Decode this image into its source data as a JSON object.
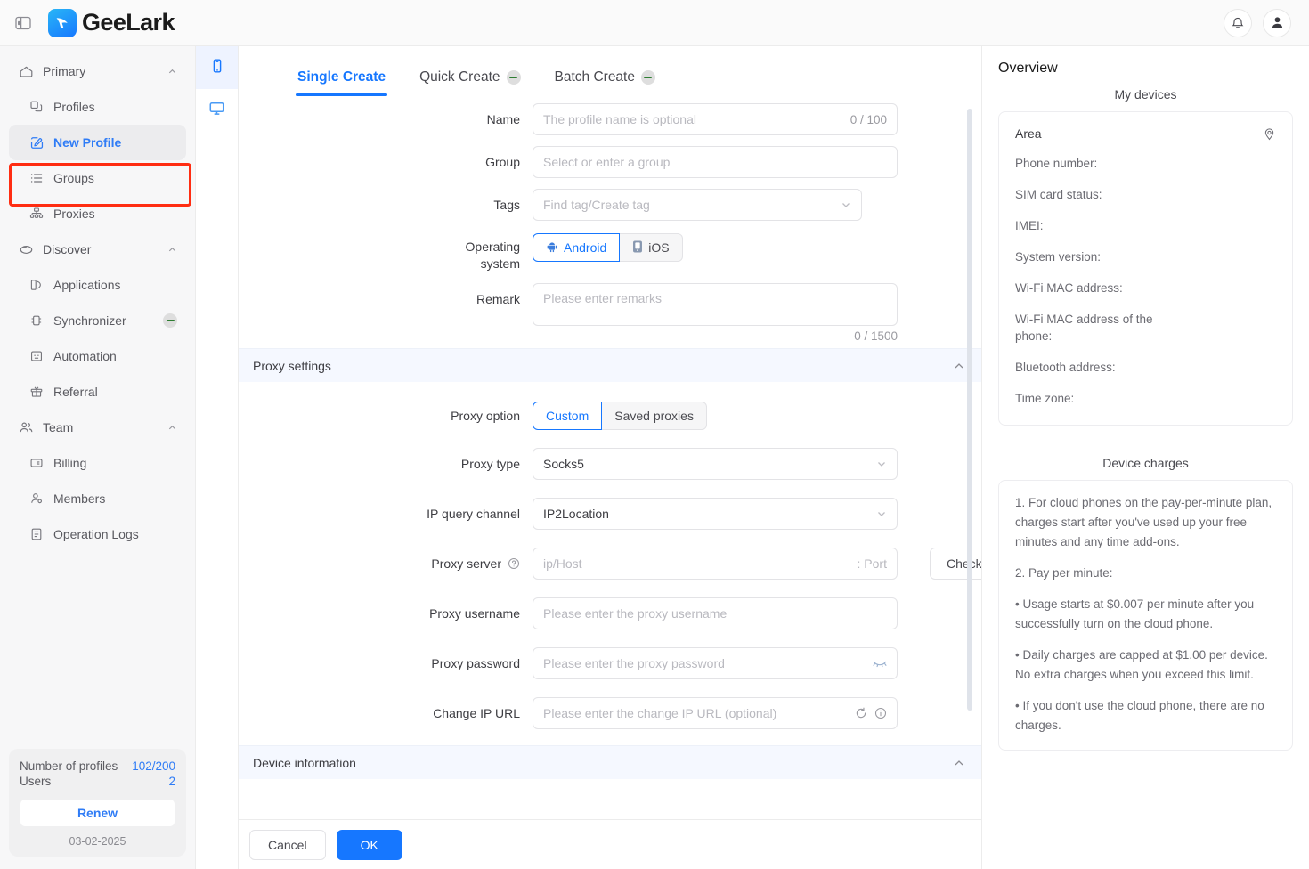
{
  "header": {
    "brand": "GeeLark",
    "panel_toggle_icon": "sidebar-toggle-icon",
    "notification_icon": "bell-icon",
    "account_icon": "user-avatar-icon"
  },
  "sidebar": {
    "groups": [
      {
        "label": "Primary",
        "icon": "home-icon",
        "expanded": true,
        "items": [
          {
            "label": "Profiles",
            "icon": "profiles-icon",
            "active": false
          },
          {
            "label": "New Profile",
            "icon": "edit-square-icon",
            "active": true
          },
          {
            "label": "Groups",
            "icon": "list-icon",
            "active": false
          },
          {
            "label": "Proxies",
            "icon": "network-icon",
            "active": false
          }
        ]
      },
      {
        "label": "Discover",
        "icon": "compass-icon",
        "expanded": true,
        "items": [
          {
            "label": "Applications",
            "icon": "apps-icon",
            "active": false
          },
          {
            "label": "Synchronizer",
            "icon": "sync-icon",
            "active": false,
            "badge": "broken-image-icon"
          },
          {
            "label": "Automation",
            "icon": "automation-icon",
            "active": false
          },
          {
            "label": "Referral",
            "icon": "gift-icon",
            "active": false
          }
        ]
      },
      {
        "label": "Team",
        "icon": "team-icon",
        "expanded": true,
        "items": [
          {
            "label": "Billing",
            "icon": "card-icon",
            "active": false
          },
          {
            "label": "Members",
            "icon": "member-icon",
            "active": false
          },
          {
            "label": "Operation Logs",
            "icon": "log-icon",
            "active": false
          }
        ]
      }
    ],
    "plan": {
      "profiles_label": "Number of profiles",
      "profiles_value": "102/200",
      "users_label": "Users",
      "users_value": "2",
      "renew_label": "Renew",
      "date": "03-02-2025"
    }
  },
  "rail": {
    "items": [
      {
        "icon": "phone-icon",
        "active": true
      },
      {
        "icon": "monitor-icon",
        "active": false
      }
    ]
  },
  "tabs": [
    {
      "label": "Single Create",
      "active": true,
      "badge": false
    },
    {
      "label": "Quick Create",
      "active": false,
      "badge": true
    },
    {
      "label": "Batch Create",
      "active": false,
      "badge": true
    }
  ],
  "form": {
    "name": {
      "label": "Name",
      "placeholder": "The profile name is optional",
      "value": "",
      "counter": "0 / 100"
    },
    "group": {
      "label": "Group",
      "placeholder": "Select or enter a group",
      "value": ""
    },
    "tags": {
      "label": "Tags",
      "placeholder": "Find tag/Create tag",
      "value": ""
    },
    "os": {
      "label": "Operating system",
      "label_line1": "Operating",
      "label_line2": "system",
      "options": [
        {
          "label": "Android",
          "selected": true,
          "icon": "android-icon"
        },
        {
          "label": "iOS",
          "selected": false,
          "icon": "apple-device-icon"
        }
      ]
    },
    "remark": {
      "label": "Remark",
      "placeholder": "Please enter remarks",
      "value": "",
      "counter": "0 / 1500"
    }
  },
  "proxy": {
    "section_title": "Proxy settings",
    "option": {
      "label": "Proxy option",
      "options": [
        {
          "label": "Custom",
          "selected": true
        },
        {
          "label": "Saved proxies",
          "selected": false
        }
      ]
    },
    "type": {
      "label": "Proxy type",
      "value": "Socks5"
    },
    "channel": {
      "label": "IP query channel",
      "value": "IP2Location"
    },
    "server": {
      "label": "Proxy server",
      "help_icon": "question-circle-icon",
      "host_placeholder": "ip/Host",
      "port_placeholder": ": Port",
      "check_label": "Check proxy"
    },
    "username": {
      "label": "Proxy username",
      "placeholder": "Please enter the proxy username",
      "value": ""
    },
    "password": {
      "label": "Proxy password",
      "placeholder": "Please enter the proxy password",
      "value": "",
      "toggle_icon": "eye-closed-icon"
    },
    "change_ip": {
      "label": "Change IP URL",
      "placeholder": "Please enter the change IP URL (optional)",
      "value": "",
      "refresh_icon": "refresh-icon",
      "info_icon": "info-circle-icon"
    }
  },
  "device_section": {
    "title": "Device information"
  },
  "footer": {
    "cancel": "Cancel",
    "ok": "OK"
  },
  "overview": {
    "title": "Overview",
    "devices_title": "My devices",
    "area_label": "Area",
    "pin_icon": "location-pin-icon",
    "fields": [
      "Phone number:",
      "SIM card status:",
      "IMEI:",
      "System version:",
      "Wi-Fi MAC address:",
      "Wi-Fi MAC address of the phone:",
      "Bluetooth address:",
      "Time zone:"
    ],
    "charges_title": "Device charges",
    "charges": [
      "1. For cloud phones on the pay-per-minute plan, charges start after you've used up your free minutes and any time add-ons.",
      "2. Pay per minute:",
      "• Usage starts at $0.007 per minute after you successfully turn on the cloud phone.",
      "• Daily charges are capped at $1.00 per device. No extra charges when you exceed this limit.",
      "• If you don't use the cloud phone, there are no charges."
    ]
  },
  "colors": {
    "accent": "#1677ff",
    "link": "#2f7cf6",
    "highlight": "#ff2d12",
    "section_bg": "#f5f8ff"
  }
}
